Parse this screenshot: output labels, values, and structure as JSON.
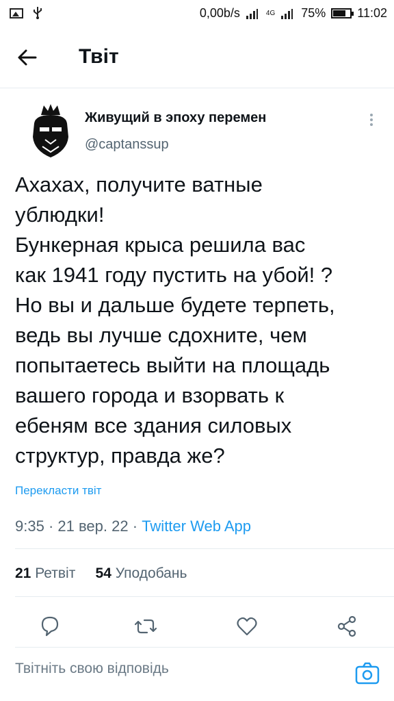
{
  "status_bar": {
    "speed": "0,00b/s",
    "network": "4G",
    "battery": "75%",
    "battery_fraction": 0.75,
    "time": "11:02"
  },
  "header": {
    "title": "Твіт"
  },
  "tweet": {
    "author_name": "Живущий в эпоху перемен",
    "author_handle": "@captanssup",
    "text": "Ахахах, получите ватные\nублюдки!\nБункерная крыса решила вас\nкак 1941 году пустить на убой! ?\nНо вы и дальше будете терпеть,\nведь вы лучше сдохните, чем\nпопытаетесь выйти на площадь\nвашего города и взорвать к\nебеням все здания силовых\nструктур, правда же?",
    "translate_label": "Перекласти твіт",
    "time": "9:35",
    "date": "21 вер. 22",
    "source": "Twitter Web App",
    "separator": "·"
  },
  "stats": {
    "retweets_count": "21",
    "retweets_label": "Ретвіт",
    "likes_count": "54",
    "likes_label": "Уподобань"
  },
  "reply": {
    "placeholder": "Твітніть свою відповідь"
  },
  "colors": {
    "accent": "#1d9bf0",
    "text": "#0f1419",
    "secondary": "#536471",
    "divider": "#e6ecf0"
  },
  "icons": [
    "image-icon",
    "usb-icon",
    "signal-icon",
    "battery-icon",
    "back-arrow-icon",
    "more-icon",
    "reply-icon",
    "retweet-icon",
    "like-icon",
    "share-icon",
    "camera-icon"
  ]
}
